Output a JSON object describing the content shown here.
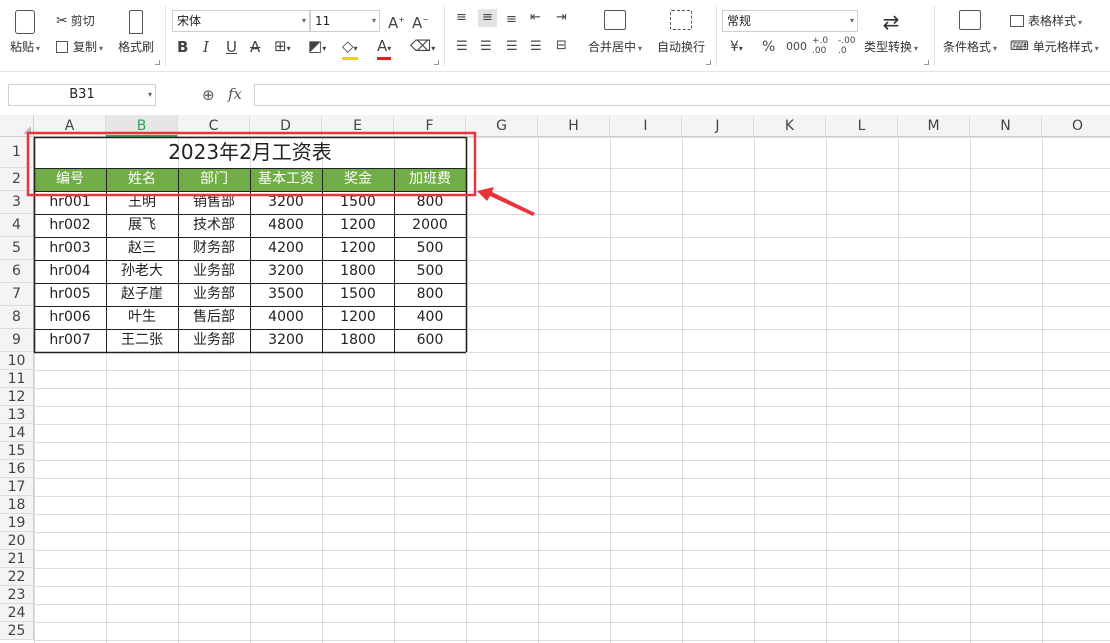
{
  "ribbon": {
    "paste": "粘贴",
    "cut": "剪切",
    "copy": "复制",
    "format_painter": "格式刷",
    "font_name": "宋体",
    "font_size": "11",
    "bold": "B",
    "italic": "I",
    "underline": "U",
    "merge_center": "合并居中",
    "wrap_text": "自动换行",
    "number_format": "常规",
    "currency": "¥",
    "percent": "%",
    "thousands": "000",
    "dec_increase": "+.0 .00",
    "dec_decrease": "-.00 .0",
    "type_convert": "类型转换",
    "cond_format": "条件格式",
    "table_style": "表格样式",
    "cell_style": "单元格样式"
  },
  "formula_bar": {
    "name_box": "B31",
    "fx": "fx",
    "formula": ""
  },
  "columns": [
    "A",
    "B",
    "C",
    "D",
    "E",
    "F",
    "G",
    "H",
    "I",
    "J",
    "K",
    "L",
    "M",
    "N",
    "O"
  ],
  "rows": [
    "1",
    "2",
    "3",
    "4",
    "5",
    "6",
    "7",
    "8",
    "9",
    "10",
    "11",
    "12",
    "13",
    "14",
    "15",
    "16",
    "17",
    "18",
    "19",
    "20",
    "21",
    "22",
    "23",
    "24",
    "25"
  ],
  "table": {
    "title": "2023年2月工资表",
    "headers": [
      "编号",
      "姓名",
      "部门",
      "基本工资",
      "奖金",
      "加班费"
    ],
    "data": [
      [
        "hr001",
        "王明",
        "销售部",
        "3200",
        "1500",
        "800"
      ],
      [
        "hr002",
        "展飞",
        "技术部",
        "4800",
        "1200",
        "2000"
      ],
      [
        "hr003",
        "赵三",
        "财务部",
        "4200",
        "1200",
        "500"
      ],
      [
        "hr004",
        "孙老大",
        "业务部",
        "3200",
        "1800",
        "500"
      ],
      [
        "hr005",
        "赵子崖",
        "业务部",
        "3500",
        "1500",
        "800"
      ],
      [
        "hr006",
        "叶生",
        "售后部",
        "4000",
        "1200",
        "400"
      ],
      [
        "hr007",
        "王二张",
        "业务部",
        "3200",
        "1800",
        "600"
      ]
    ]
  },
  "colors": {
    "header_green": "#70ad47",
    "annotation_red": "#e8343a",
    "selected_col": "#2fa35c"
  }
}
